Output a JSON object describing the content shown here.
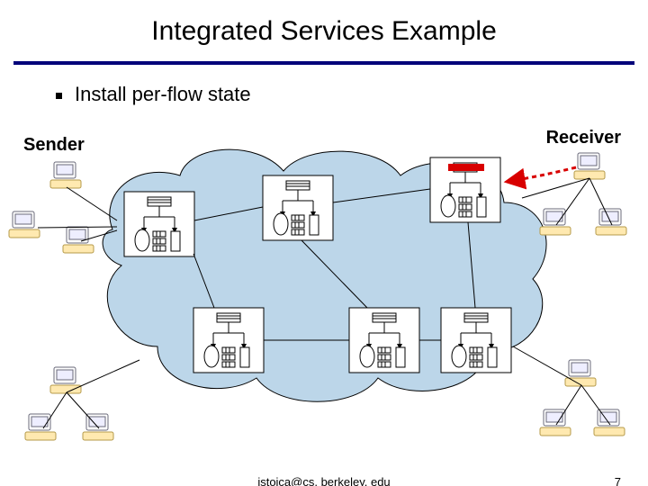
{
  "title": "Integrated Services Example",
  "bullet": "Install per-flow state",
  "labels": {
    "sender": "Sender",
    "receiver": "Receiver"
  },
  "footer": {
    "email": "istoica@cs. berkeley. edu",
    "page": "7"
  },
  "colors": {
    "rule": "#00007a",
    "cloud": "#bcd6e9",
    "accent": "#d80000"
  }
}
